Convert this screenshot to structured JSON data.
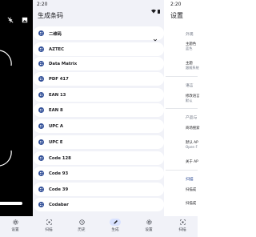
{
  "status": {
    "time_middle": "2:20",
    "time_right": "2:20"
  },
  "header": {
    "title": "生成条码",
    "settings_title": "设置"
  },
  "barcode_types": [
    {
      "label": "二维码",
      "expandable": true
    },
    {
      "label": "AZTEC"
    },
    {
      "label": "Data Matrix"
    },
    {
      "label": "PDF 417"
    },
    {
      "label": "EAN 13"
    },
    {
      "label": "EAN 8"
    },
    {
      "label": "UPC A"
    },
    {
      "label": "UPC E"
    },
    {
      "label": "Code 128"
    },
    {
      "label": "Code 93"
    },
    {
      "label": "Code 39"
    },
    {
      "label": "Codabar"
    }
  ],
  "settings": {
    "section_appearance": "外观",
    "theme_color_title": "主题色",
    "theme_color_value": "蓝色",
    "theme_title": "主题",
    "theme_value": "跟随系统",
    "section_language": "语言",
    "language_title": "修改语言",
    "language_value": "默认",
    "section_product": "产品与",
    "product_search": "商场搜索",
    "default_title": "默认 AP",
    "default_value": "Open F",
    "about_title": "关于 AP",
    "section_scan": "扫描",
    "scan_item_1": "扫描成",
    "scan_item_2": "扫描成"
  },
  "bottom_nav": [
    {
      "label": "设置"
    },
    {
      "label": "扫描"
    },
    {
      "label": "历史"
    },
    {
      "label": "生成",
      "active": true
    },
    {
      "label": "设置"
    },
    {
      "label": "扫描"
    }
  ],
  "colors": {
    "accent": "#36539a",
    "active_pill": "#d9e2ff",
    "background": "#f1f2f8"
  }
}
